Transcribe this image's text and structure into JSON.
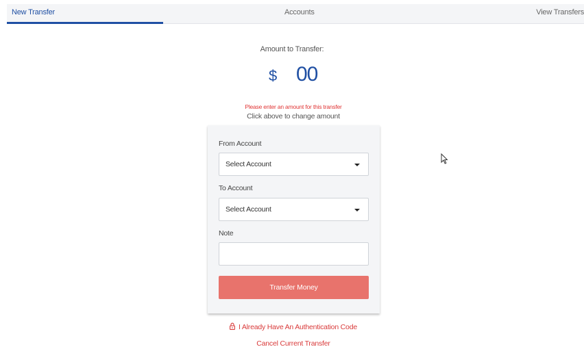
{
  "tabs": {
    "new_transfer": "New Transfer",
    "accounts": "Accounts",
    "view_transfers": "View Transfers",
    "active": "New Transfer"
  },
  "amount": {
    "label": "Amount to Transfer:",
    "currency": "$",
    "value": "00",
    "error": "Please enter an amount for this transfer",
    "hint": "Click above to change amount"
  },
  "form": {
    "from_label": "From Account",
    "from_value": "Select Account",
    "to_label": "To Account",
    "to_value": "Select Account",
    "note_label": "Note",
    "note_value": "",
    "submit_label": "Transfer Money"
  },
  "links": {
    "auth_code": "I Already Have An Authentication Code",
    "cancel": "Cancel Current Transfer"
  },
  "icons": {
    "lock": "lock-icon",
    "caret": "caret-down-icon",
    "cursor": "mouse-pointer-icon"
  },
  "colors": {
    "accent": "#1f4fa3",
    "error": "#e03434",
    "button": "#e8736c"
  }
}
